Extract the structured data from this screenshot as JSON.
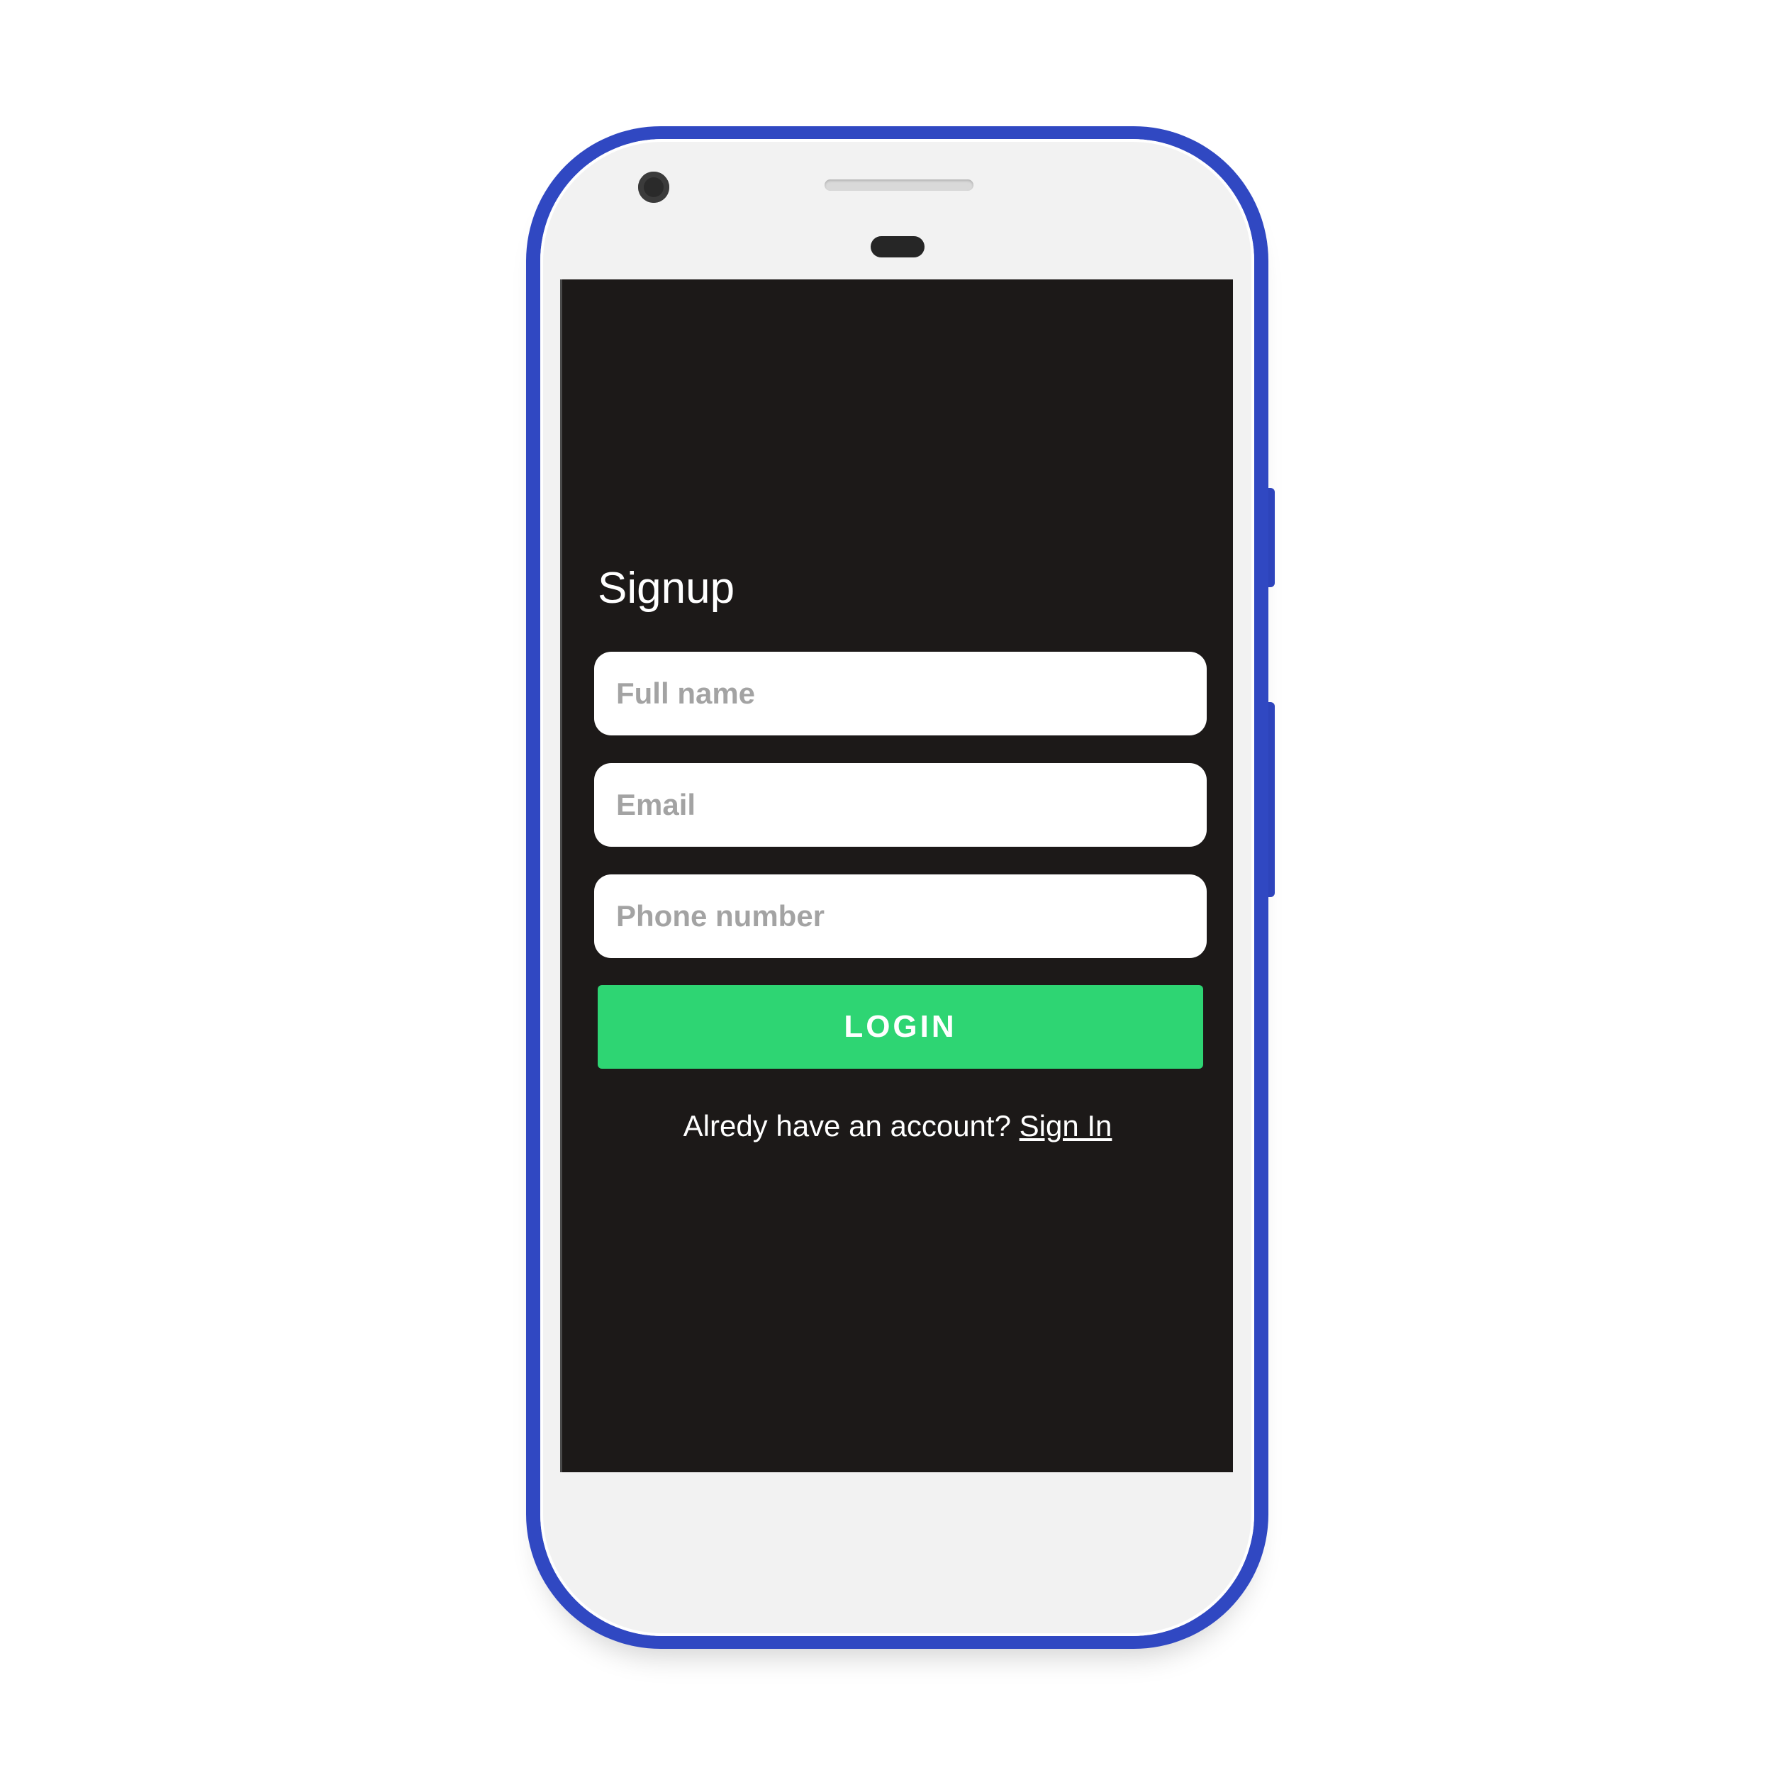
{
  "screen": {
    "title": "Signup",
    "fields": [
      {
        "placeholder": "Full name",
        "value": ""
      },
      {
        "placeholder": "Email",
        "value": ""
      },
      {
        "placeholder": "Phone number",
        "value": ""
      }
    ],
    "login_label": "LOGIN",
    "account_prompt": "Alredy have an account?",
    "sign_in_label": "Sign In"
  },
  "colors": {
    "phone_frame": "#3048c2",
    "screen_background": "#1c1918",
    "button_accent": "#2ed573"
  }
}
